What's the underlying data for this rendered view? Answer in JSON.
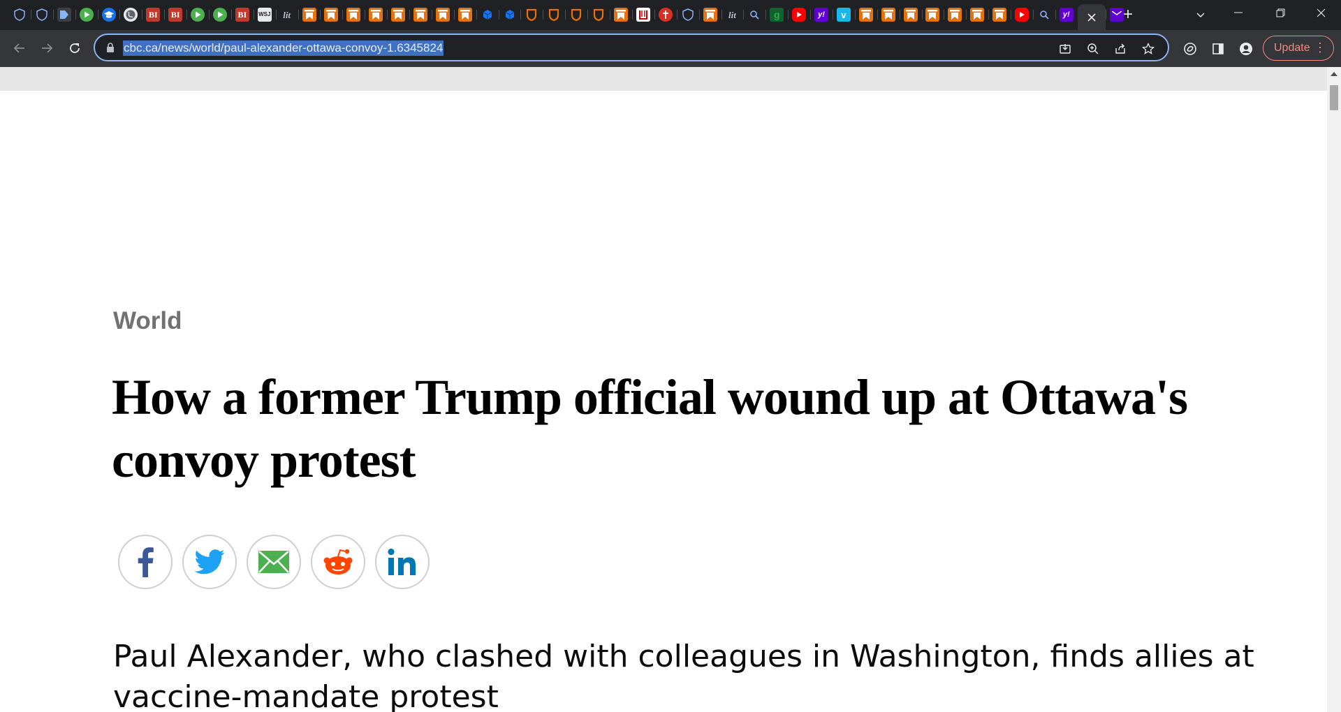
{
  "browser": {
    "tab_favicons": [
      "shield-icon",
      "shield-icon",
      "dark-arrow-icon",
      "play-icon",
      "graduation-cap-icon",
      "globe-icon",
      "bi-icon",
      "bi-icon",
      "play-icon",
      "play-icon",
      "bi-icon",
      "wsj-icon",
      "lit-icon",
      "bookmark-icon",
      "bookmark-icon",
      "bookmark-icon",
      "bookmark-icon",
      "bookmark-icon",
      "bookmark-icon",
      "bookmark-icon",
      "bookmark-icon",
      "cube-icon",
      "cube-icon",
      "badge-icon",
      "badge-icon",
      "badge-icon",
      "badge-icon",
      "bookmark-icon",
      "tab3-icon",
      "red-pin-icon",
      "shield-icon",
      "bookmark-icon",
      "lit-icon",
      "search-icon",
      "g-icon",
      "youtube-icon",
      "yahoo-icon",
      "vimeo-icon",
      "bookmark-icon",
      "bookmark-icon",
      "bookmark-icon",
      "bookmark-icon",
      "bookmark-icon",
      "bookmark-icon",
      "bookmark-icon",
      "youtube-icon",
      "search-icon",
      "yahoo-icon"
    ],
    "bi_text": "BI",
    "lit_text": "lit",
    "wsj_text": "WSJ",
    "g_text": "g",
    "yahoo_text": "y!",
    "vimeo_text": "v",
    "new_tab_label": "+",
    "url": "cbc.ca/news/world/paul-alexander-ottawa-convoy-1.6345824",
    "update_label": "Update"
  },
  "article": {
    "category": "World",
    "headline": "How a former Trump official wound up at Ottawa's convoy protest",
    "deck": "Paul Alexander, who clashed with colleagues in Washington, finds allies at vaccine-mandate protest"
  },
  "share_buttons": [
    "facebook-icon",
    "twitter-icon",
    "email-icon",
    "reddit-icon",
    "linkedin-icon"
  ],
  "colors": {
    "tab_strip": "#202124",
    "toolbar": "#35363a",
    "url_highlight": "#3e72c0",
    "facebook": "#3b5998",
    "twitter": "#1da1f2",
    "email": "#4caf50",
    "reddit": "#ff4500",
    "linkedin": "#0077b5",
    "update_accent": "#f28b82"
  }
}
